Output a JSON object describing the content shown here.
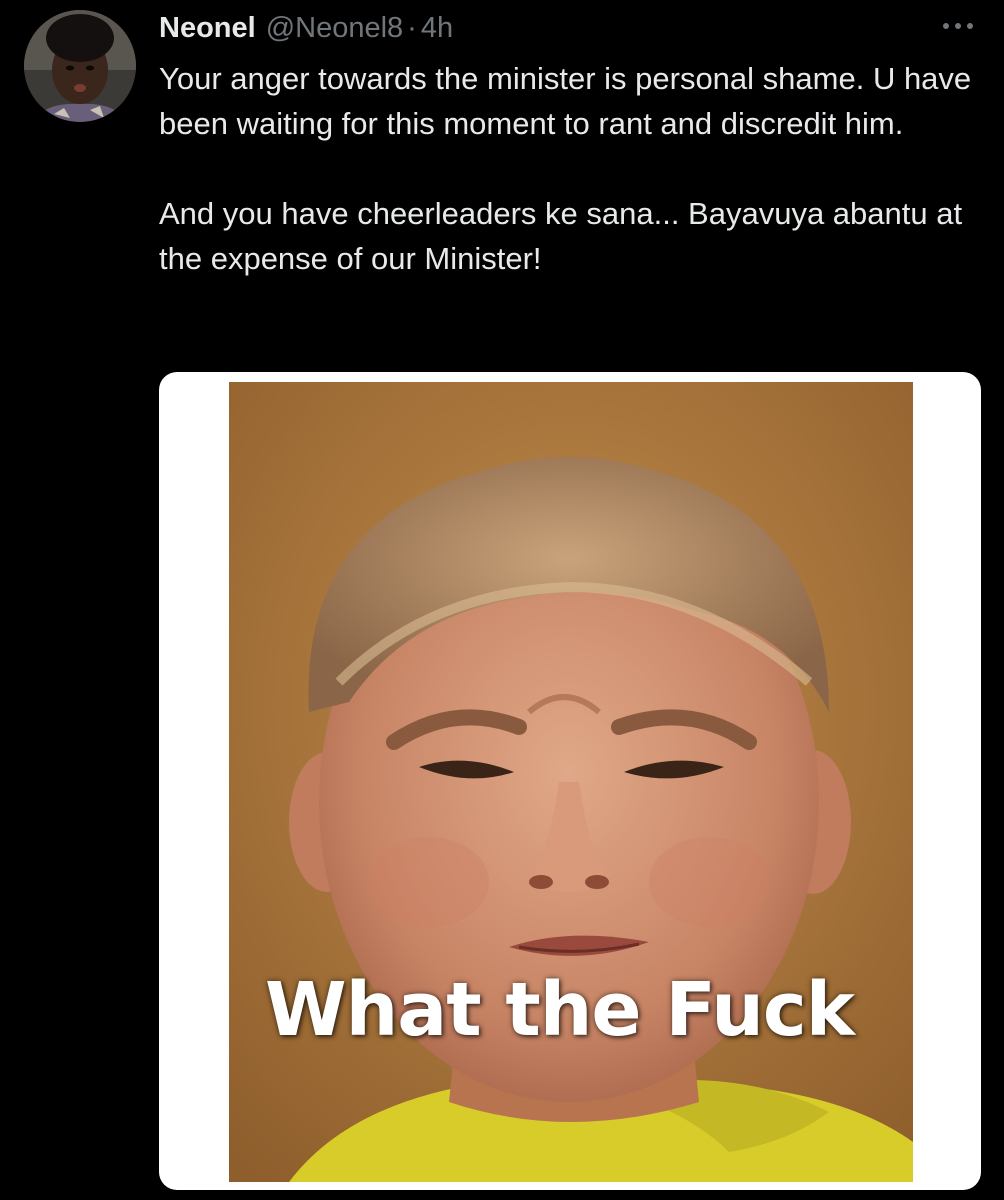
{
  "tweet": {
    "author": {
      "display_name": "Neonel",
      "handle": "@Neonel8",
      "separator": "·",
      "time": "4h"
    },
    "body": {
      "paragraph_1": "Your anger towards the minister is personal shame. U have been waiting for this moment to rant and discredit him.",
      "paragraph_2": "And you have cheerleaders ke sana... Bayavuya abantu at the expense of our Minister!"
    },
    "media": {
      "caption": "What the Fuck"
    },
    "icons": {
      "more": "more-options-icon",
      "avatar": "profile-avatar"
    }
  },
  "colors": {
    "background": "#000000",
    "primary_text": "#e7e9ea",
    "secondary_text": "#71767b",
    "media_frame": "#ffffff"
  }
}
